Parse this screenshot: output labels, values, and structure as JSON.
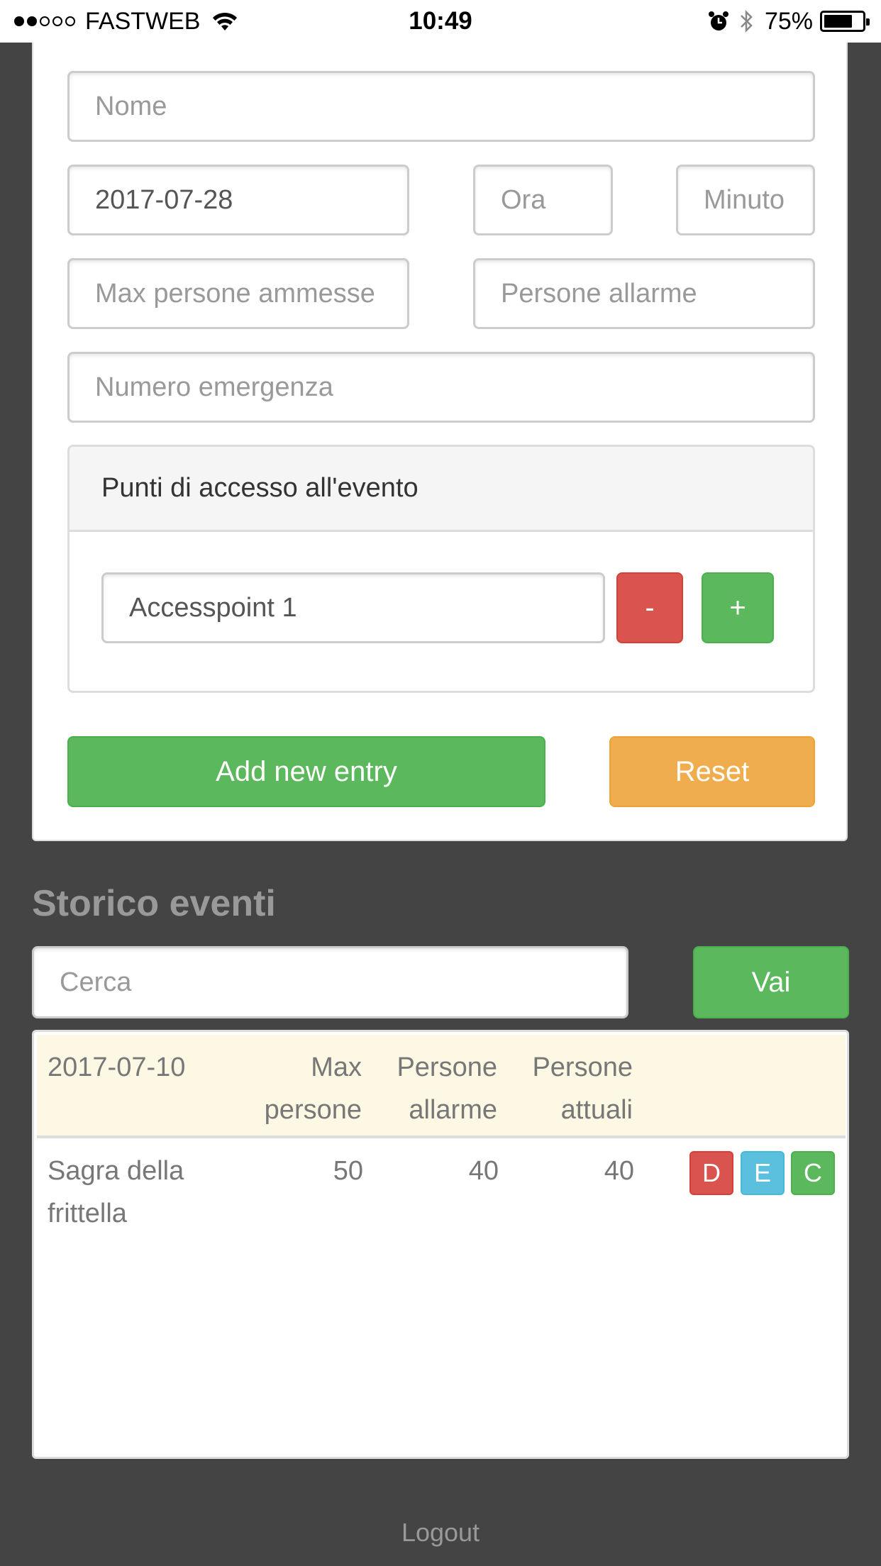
{
  "status_bar": {
    "carrier": "FASTWEB",
    "time": "10:49",
    "battery": "75%",
    "signal_bars_filled": 2,
    "signal_bars_total": 5,
    "battery_level": 0.75
  },
  "form": {
    "name_placeholder": "Nome",
    "date_value": "2017-07-28",
    "hour_placeholder": "Ora",
    "minute_placeholder": "Minuto",
    "max_people_placeholder": "Max persone ammesse",
    "alarm_people_placeholder": "Persone allarme",
    "emergency_number_placeholder": "Numero emergenza",
    "access_panel": {
      "title": "Punti di accesso all'evento",
      "accesspoint_value": "Accesspoint 1",
      "remove_label": "-",
      "add_label": "+"
    },
    "add_entry_label": "Add new entry",
    "reset_label": "Reset"
  },
  "history": {
    "title": "Storico eventi",
    "search_placeholder": "Cerca",
    "search_button": "Vai",
    "table": {
      "headers": {
        "date": "2017-07-10",
        "max_people": [
          "Max",
          "persone"
        ],
        "alarm_people": [
          "Persone",
          "allarme"
        ],
        "current_people": [
          "Persone",
          "attuali"
        ]
      },
      "rows": [
        {
          "name": [
            "Sagra della",
            "frittella"
          ],
          "max_people": "50",
          "alarm_people": "40",
          "current_people": "40",
          "actions": [
            "D",
            "E",
            "C"
          ]
        }
      ]
    }
  },
  "footer": {
    "logout_label": "Logout"
  },
  "colors": {
    "background": "#444444",
    "danger": "#d9534f",
    "success": "#5cb85c",
    "warning": "#f0ad4e",
    "info": "#5bc0de",
    "table_header_bg": "#fcf8e3"
  }
}
